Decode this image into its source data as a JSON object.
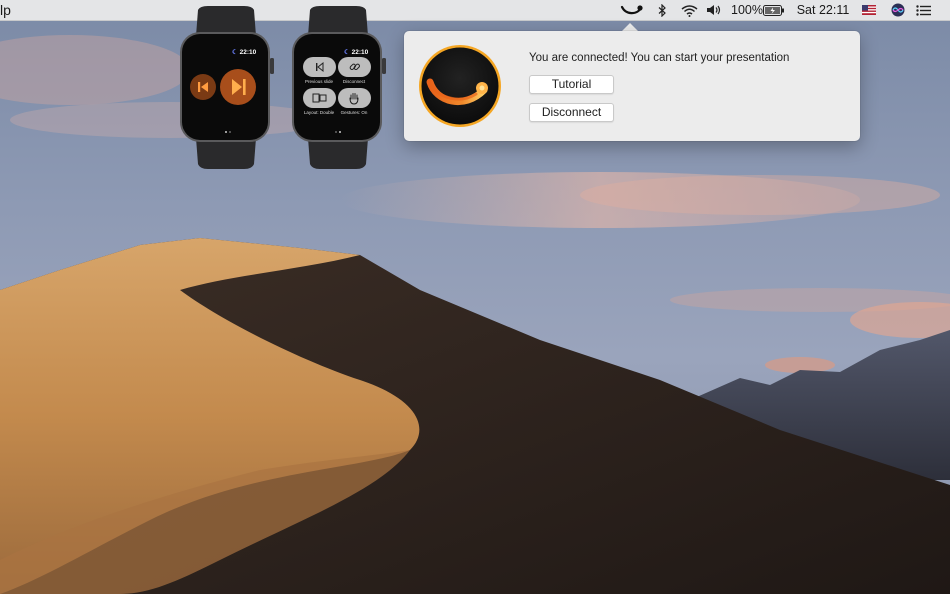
{
  "menubar": {
    "app_menu_fragment": "lp",
    "battery_percent": "100%",
    "clock": "Sat 22:11",
    "icons": [
      "presentation-remote-icon",
      "bluetooth-icon",
      "wifi-icon",
      "volume-icon",
      "battery-icon",
      "flag-us-icon",
      "siri-icon",
      "notification-center-icon"
    ]
  },
  "popover": {
    "message": "You are connected! You can start your presentation",
    "tutorial_label": "Tutorial",
    "disconnect_label": "Disconnect"
  },
  "watch_left": {
    "time": "22:10",
    "controls": [
      "previous-icon",
      "next-icon"
    ]
  },
  "watch_right": {
    "time": "22:10",
    "tiles": [
      {
        "label": "Previous slide",
        "icon": "previous-slide-icon"
      },
      {
        "label": "Disconnect",
        "icon": "link-icon"
      },
      {
        "label": "Layout: Double",
        "icon": "layout-icon"
      },
      {
        "label": "Gestures: On",
        "icon": "hand-icon"
      }
    ]
  },
  "colors": {
    "accent_orange": "#e8621a",
    "logo_ring": "#f5a623",
    "popover_bg": "#ececec"
  }
}
